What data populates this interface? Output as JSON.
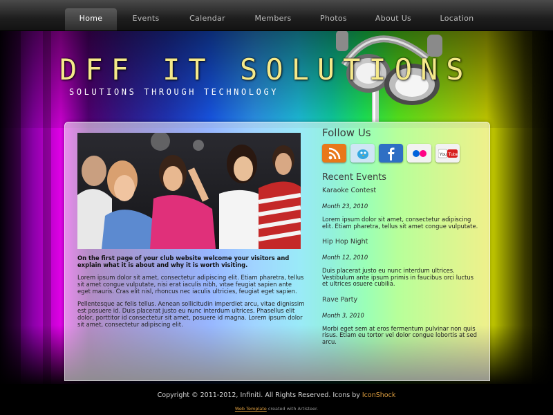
{
  "nav": {
    "items": [
      {
        "label": "Home",
        "active": true
      },
      {
        "label": "Events"
      },
      {
        "label": "Calendar"
      },
      {
        "label": "Members"
      },
      {
        "label": "Photos"
      },
      {
        "label": "About Us"
      },
      {
        "label": "Location"
      }
    ]
  },
  "header": {
    "title": "DFF IT SOLUTIONS",
    "slogan": "SOLUTIONS THROUGH TECHNOLOGY"
  },
  "main": {
    "intro": "On the first page of your club website welcome your visitors and explain what it is about and why it is worth visiting.",
    "paragraph1": "Lorem ipsum dolor sit amet, consectetur adipiscing elit. Etiam pharetra, tellus sit amet congue vulputate, nisi erat iaculis nibh, vitae feugiat sapien ante eget mauris. Cras elit nisl, rhoncus nec iaculis ultricies, feugiat eget sapien.",
    "paragraph2": "Pellentesque ac felis tellus. Aenean sollicitudin imperdiet arcu, vitae dignissim est posuere id. Duis placerat justo eu nunc interdum ultrices. Phasellus elit dolor, porttitor id consectetur sit amet, posuere id magna. Lorem ipsum dolor sit amet, consectetur adipiscing elit."
  },
  "sidebar": {
    "follow_heading": "Follow Us",
    "socials": [
      {
        "icon": "rss-icon",
        "color": "#e8781a"
      },
      {
        "icon": "twitter-icon",
        "color": "#cfe6f5"
      },
      {
        "icon": "facebook-icon",
        "color": "#2f6fc4"
      },
      {
        "icon": "flickr-icon",
        "color": "#f2f2f2"
      },
      {
        "icon": "youtube-icon",
        "color": "#f2f2f2"
      }
    ],
    "events_heading": "Recent Events",
    "events": [
      {
        "title": "Karaoke Contest",
        "date": "Month 23, 2010",
        "text": "Lorem ipsum dolor sit amet, consectetur adipiscing elit. Etiam pharetra, tellus sit amet congue vulputate."
      },
      {
        "title": "Hip Hop Night",
        "date": "Month 12, 2010",
        "text": "Duis placerat justo eu nunc interdum ultrices. Vestibulum ante ipsum primis in faucibus orci luctus et ultrices osuere cubilia."
      },
      {
        "title": "Rave Party",
        "date": "Month 3, 2010",
        "text": "Morbi eget sem at eros fermentum pulvinar non quis risus. Etiam eu tortor vel dolor congue lobortis at sed arcu."
      }
    ]
  },
  "footer": {
    "copyright": "Copyright © 2011-2012, Infiniti. All Rights Reserved. Icons by ",
    "icons_link": "IconShock",
    "template_link": "Web Template",
    "created_with": " created with Artisteer."
  }
}
